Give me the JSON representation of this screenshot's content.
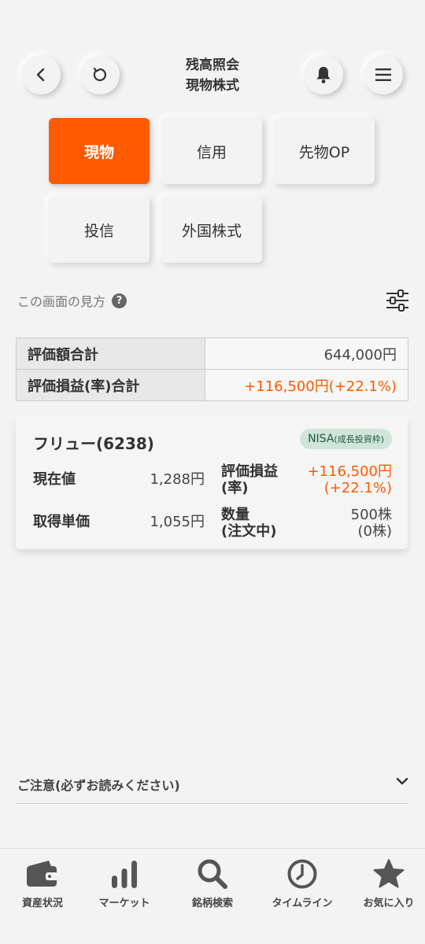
{
  "header": {
    "title_line1": "残高照会",
    "title_line2": "現物株式",
    "back_icon": "chevron-left-icon",
    "refresh_icon": "refresh-icon",
    "bell_icon": "bell-icon",
    "menu_icon": "hamburger-menu-icon"
  },
  "tabs": [
    {
      "label": "現物",
      "active": true
    },
    {
      "label": "信用",
      "active": false
    },
    {
      "label": "先物OP",
      "active": false
    },
    {
      "label": "投信",
      "active": false
    },
    {
      "label": "外国株式",
      "active": false
    }
  ],
  "help": {
    "label": "この画面の見方",
    "icon_glyph": "?"
  },
  "summary": {
    "rows": [
      {
        "label": "評価額合計",
        "value": "644,000円"
      },
      {
        "label": "評価損益(率)合計",
        "value": "+116,500円(+22.1%)"
      }
    ]
  },
  "holding": {
    "name": "フリュー(6238)",
    "badge_main": "NISA",
    "badge_sub": "(成長投資枠)",
    "current_price_label": "現在値",
    "current_price": "1,288円",
    "pl_label_1": "評価損益",
    "pl_label_2": "(率)",
    "pl_value": "+116,500円",
    "pl_rate": "(+22.1%)",
    "cost_label": "取得単価",
    "cost_value": "1,055円",
    "qty_label_1": "数量",
    "qty_label_2": "(注文中)",
    "qty_value": "500株",
    "qty_pending": "(0株)"
  },
  "notice": {
    "label": "ご注意(必ずお読みください)"
  },
  "bottom_nav": [
    {
      "label": "資産状況",
      "icon": "wallet-icon"
    },
    {
      "label": "マーケット",
      "icon": "bar-chart-icon"
    },
    {
      "label": "銘柄検索",
      "icon": "search-icon"
    },
    {
      "label": "タイムライン",
      "icon": "clock-icon"
    },
    {
      "label": "お気に入り",
      "icon": "star-icon"
    }
  ],
  "colors": {
    "accent": "#ff5a00",
    "background": "#f3f3f3",
    "nisa_badge": "#cfe5da"
  }
}
